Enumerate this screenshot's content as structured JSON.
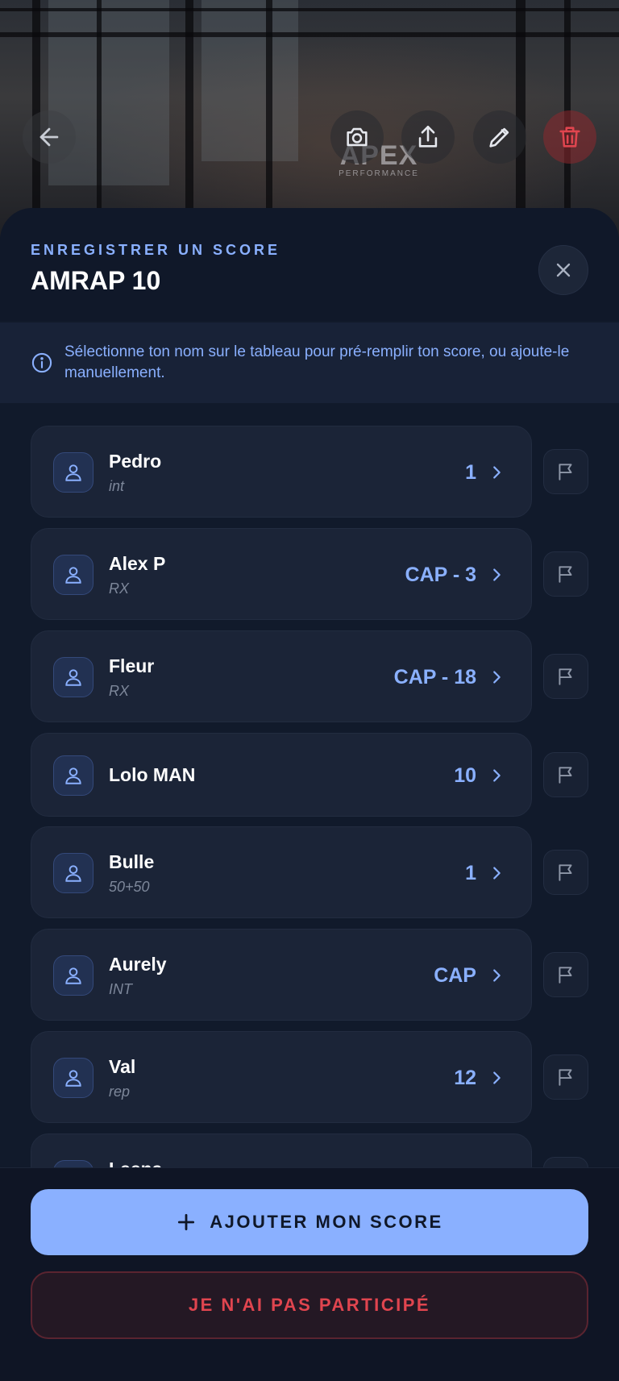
{
  "hero": {
    "brand_name": "APEX",
    "brand_tagline": "PERFORMANCE",
    "buttons": [
      "arrow-left-icon",
      "camera-icon",
      "share-icon",
      "pencil-icon",
      "trash-icon"
    ]
  },
  "sheet": {
    "eyebrow": "ENREGISTRER UN SCORE",
    "title": "AMRAP 10",
    "info_text": "Sélectionne ton nom sur le tableau pour pré-remplir ton score, ou ajoute-le manuellement."
  },
  "athletes": [
    {
      "name": "Pedro",
      "sub": "int",
      "score": "1"
    },
    {
      "name": "Alex P",
      "sub": "RX",
      "score": "CAP - 3"
    },
    {
      "name": "Fleur",
      "sub": "RX",
      "score": "CAP - 18"
    },
    {
      "name": "Lolo MAN",
      "sub": "",
      "score": "10"
    },
    {
      "name": "Bulle",
      "sub": "50+50",
      "score": "1"
    },
    {
      "name": "Aurely",
      "sub": "INT",
      "score": "CAP"
    },
    {
      "name": "Val",
      "sub": "rep",
      "score": "12"
    },
    {
      "name": "Leena",
      "sub": "",
      "score": ""
    }
  ],
  "actions": {
    "add_label": "AJOUTER MON SCORE",
    "skip_label": "JE N'AI PAS PARTICIPÉ"
  },
  "colors": {
    "accent": "#8ab0ff",
    "danger": "#e0454f",
    "background": "#111a2b"
  }
}
